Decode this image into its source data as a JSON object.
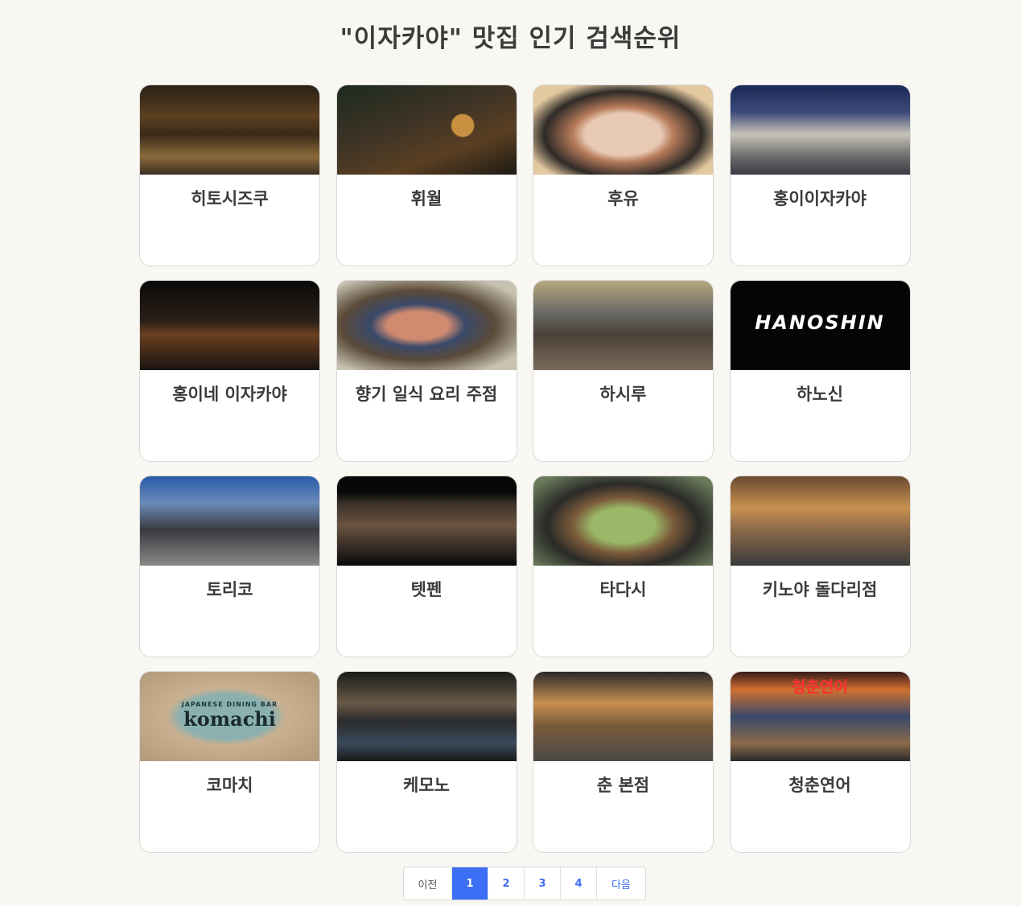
{
  "page": {
    "title": "\"이자카야\" 맛집 인기 검색순위"
  },
  "restaurants": [
    {
      "name": "히토시즈쿠",
      "image": "restaurant-photo"
    },
    {
      "name": "휘월",
      "image": "restaurant-photo"
    },
    {
      "name": "후유",
      "image": "restaurant-photo"
    },
    {
      "name": "홍이이자카야",
      "image": "restaurant-photo"
    },
    {
      "name": "홍이네 이자카야",
      "image": "restaurant-photo"
    },
    {
      "name": "향기 일식 요리 주점",
      "image": "restaurant-photo"
    },
    {
      "name": "하시루",
      "image": "restaurant-photo"
    },
    {
      "name": "하노신",
      "image": "restaurant-photo",
      "sign_text": "HANOSHIN"
    },
    {
      "name": "토리코",
      "image": "restaurant-photo"
    },
    {
      "name": "텟펜",
      "image": "restaurant-photo"
    },
    {
      "name": "타다시",
      "image": "restaurant-photo"
    },
    {
      "name": "키노야 돌다리점",
      "image": "restaurant-photo"
    },
    {
      "name": "코마치",
      "image": "restaurant-photo",
      "sign_text": "komachi",
      "sign_subtext": "JAPANESE DINING BAR"
    },
    {
      "name": "케모노",
      "image": "restaurant-photo"
    },
    {
      "name": "춘 본점",
      "image": "restaurant-photo"
    },
    {
      "name": "청춘연어",
      "image": "restaurant-photo",
      "sign_text": "청춘연어"
    }
  ],
  "pagination": {
    "prev_label": "이전",
    "pages": [
      "1",
      "2",
      "3",
      "4"
    ],
    "current_page": "1",
    "next_label": "다음"
  },
  "colors": {
    "background": "#f8f7f1",
    "card": "#ffffff",
    "accent": "#3c6ef6"
  }
}
